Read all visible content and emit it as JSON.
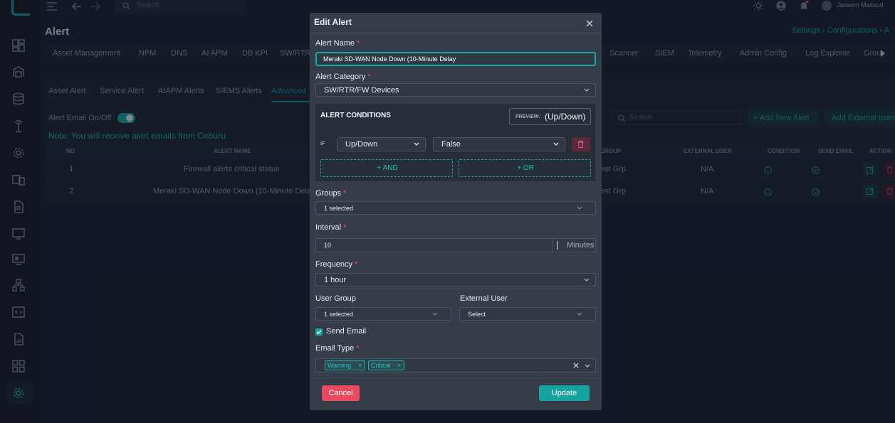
{
  "topbar": {
    "search_placeholder": "Search",
    "user_name": "Jaseem Massod"
  },
  "page": {
    "title": "Alert",
    "breadcrumb": "Settings › Configurations › A"
  },
  "main_tabs": [
    "Asset Management",
    "NPM",
    "DNS",
    "AI APM",
    "DB KPI",
    "SW/RTR",
    "Scanner",
    "SIEM",
    "Telemetry",
    "Admin Config",
    "Log Explorer",
    "Grou"
  ],
  "alert_tabs": [
    "Asset Alert",
    "Service Alert",
    "AIAPM Alerts",
    "SIEMS Alerts",
    "Advanced"
  ],
  "email_toggle_label": "Alert Email On/Off",
  "note": "Note: You will receive alert emails from Ceburu.",
  "list_search_placeholder": "Search",
  "add_new_alert": "+ Add New Alert",
  "add_external_user": "Add External users",
  "table": {
    "headers": [
      "NO",
      "ALERT NAME",
      "GROUP",
      "EXTERNAL USER",
      "CONDITION",
      "SEND EMAIL",
      "ACTION"
    ],
    "rows": [
      {
        "no": "1",
        "name": "Firewall alerts critical status",
        "group": "est Grp",
        "external_user": "N/A"
      },
      {
        "no": "2",
        "name": "Meraki SD-WAN Node Down (10-Minute Delay",
        "group": "est Grp",
        "external_user": "N/A"
      }
    ]
  },
  "modal": {
    "title": "Edit Alert",
    "alert_name_label": "Alert Name",
    "alert_name_value": "Meraki SD-WAN Node Down (10-Minute Delay",
    "alert_category_label": "Alert Category",
    "alert_category_value": "SW/RTR/FW Devices",
    "conditions_title": "ALERT CONDITIONS",
    "preview_label": "PREVIEW:",
    "preview_value": "(Up/Down)",
    "if_label": "IF",
    "condition_field": "Up/Down",
    "condition_value": "False",
    "and_button": "+ AND",
    "or_button": "+ OR",
    "groups_label": "Groups",
    "groups_value": "1 selected",
    "interval_label": "Interval",
    "interval_value": "10",
    "interval_unit": "Minutes",
    "frequency_label": "Frequency",
    "frequency_value": "1 hour",
    "user_group_label": "User Group",
    "user_group_value": "1 selected",
    "external_user_label": "External User",
    "external_user_value": "Select",
    "send_email_label": "Send Email",
    "send_email_checked": true,
    "email_type_label": "Email Type",
    "email_types": [
      "Warning",
      "Critical"
    ],
    "cancel_label": "Cancel",
    "update_label": "Update",
    "required_mark": "*"
  },
  "colors": {
    "accent": "#16a2a1",
    "danger": "#e74a5f",
    "teal_text": "#21c4b7"
  }
}
